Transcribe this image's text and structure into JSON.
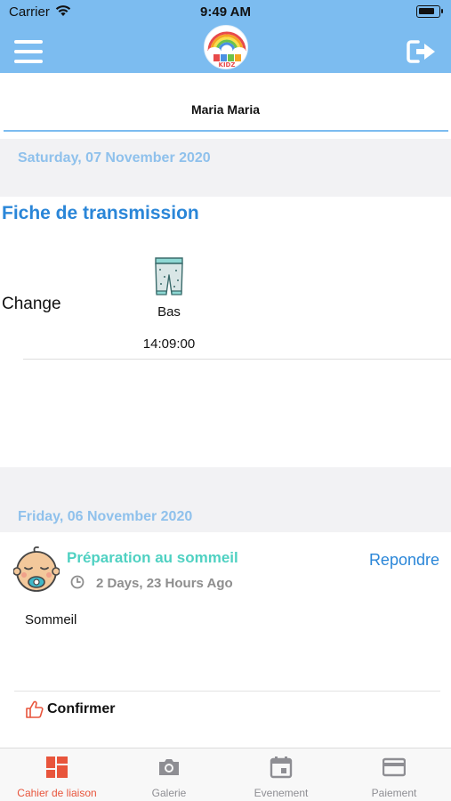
{
  "status_bar": {
    "carrier": "Carrier",
    "time": "9:49 AM"
  },
  "navbar": {
    "logo_text": "KIDZ"
  },
  "child": {
    "name": "Maria Maria"
  },
  "sections": [
    {
      "date": "Saturday, 07 November 2020",
      "fiche": {
        "title": "Fiche de transmission",
        "row_label": "Change",
        "item_name": "Bas",
        "item_time": "14:09:00"
      }
    },
    {
      "date": "Friday, 06 November 2020",
      "note": {
        "title": "Préparation au sommeil",
        "time_ago": "2 Days, 23 Hours Ago",
        "reply_label": "Repondre",
        "body": "Sommeil",
        "confirm_label": "Confirmer"
      }
    }
  ],
  "tabs": [
    {
      "label": "Cahier de liaison",
      "icon": "notebook-grid-icon",
      "active": true
    },
    {
      "label": "Galerie",
      "icon": "camera-icon",
      "active": false
    },
    {
      "label": "Evenement",
      "icon": "calendar-icon",
      "active": false
    },
    {
      "label": "Paiement",
      "icon": "credit-card-icon",
      "active": false
    }
  ],
  "colors": {
    "header_blue": "#7cbcf0",
    "title_blue": "#2a86d8",
    "note_teal": "#4fd1c2",
    "active_tab": "#e8553c"
  }
}
